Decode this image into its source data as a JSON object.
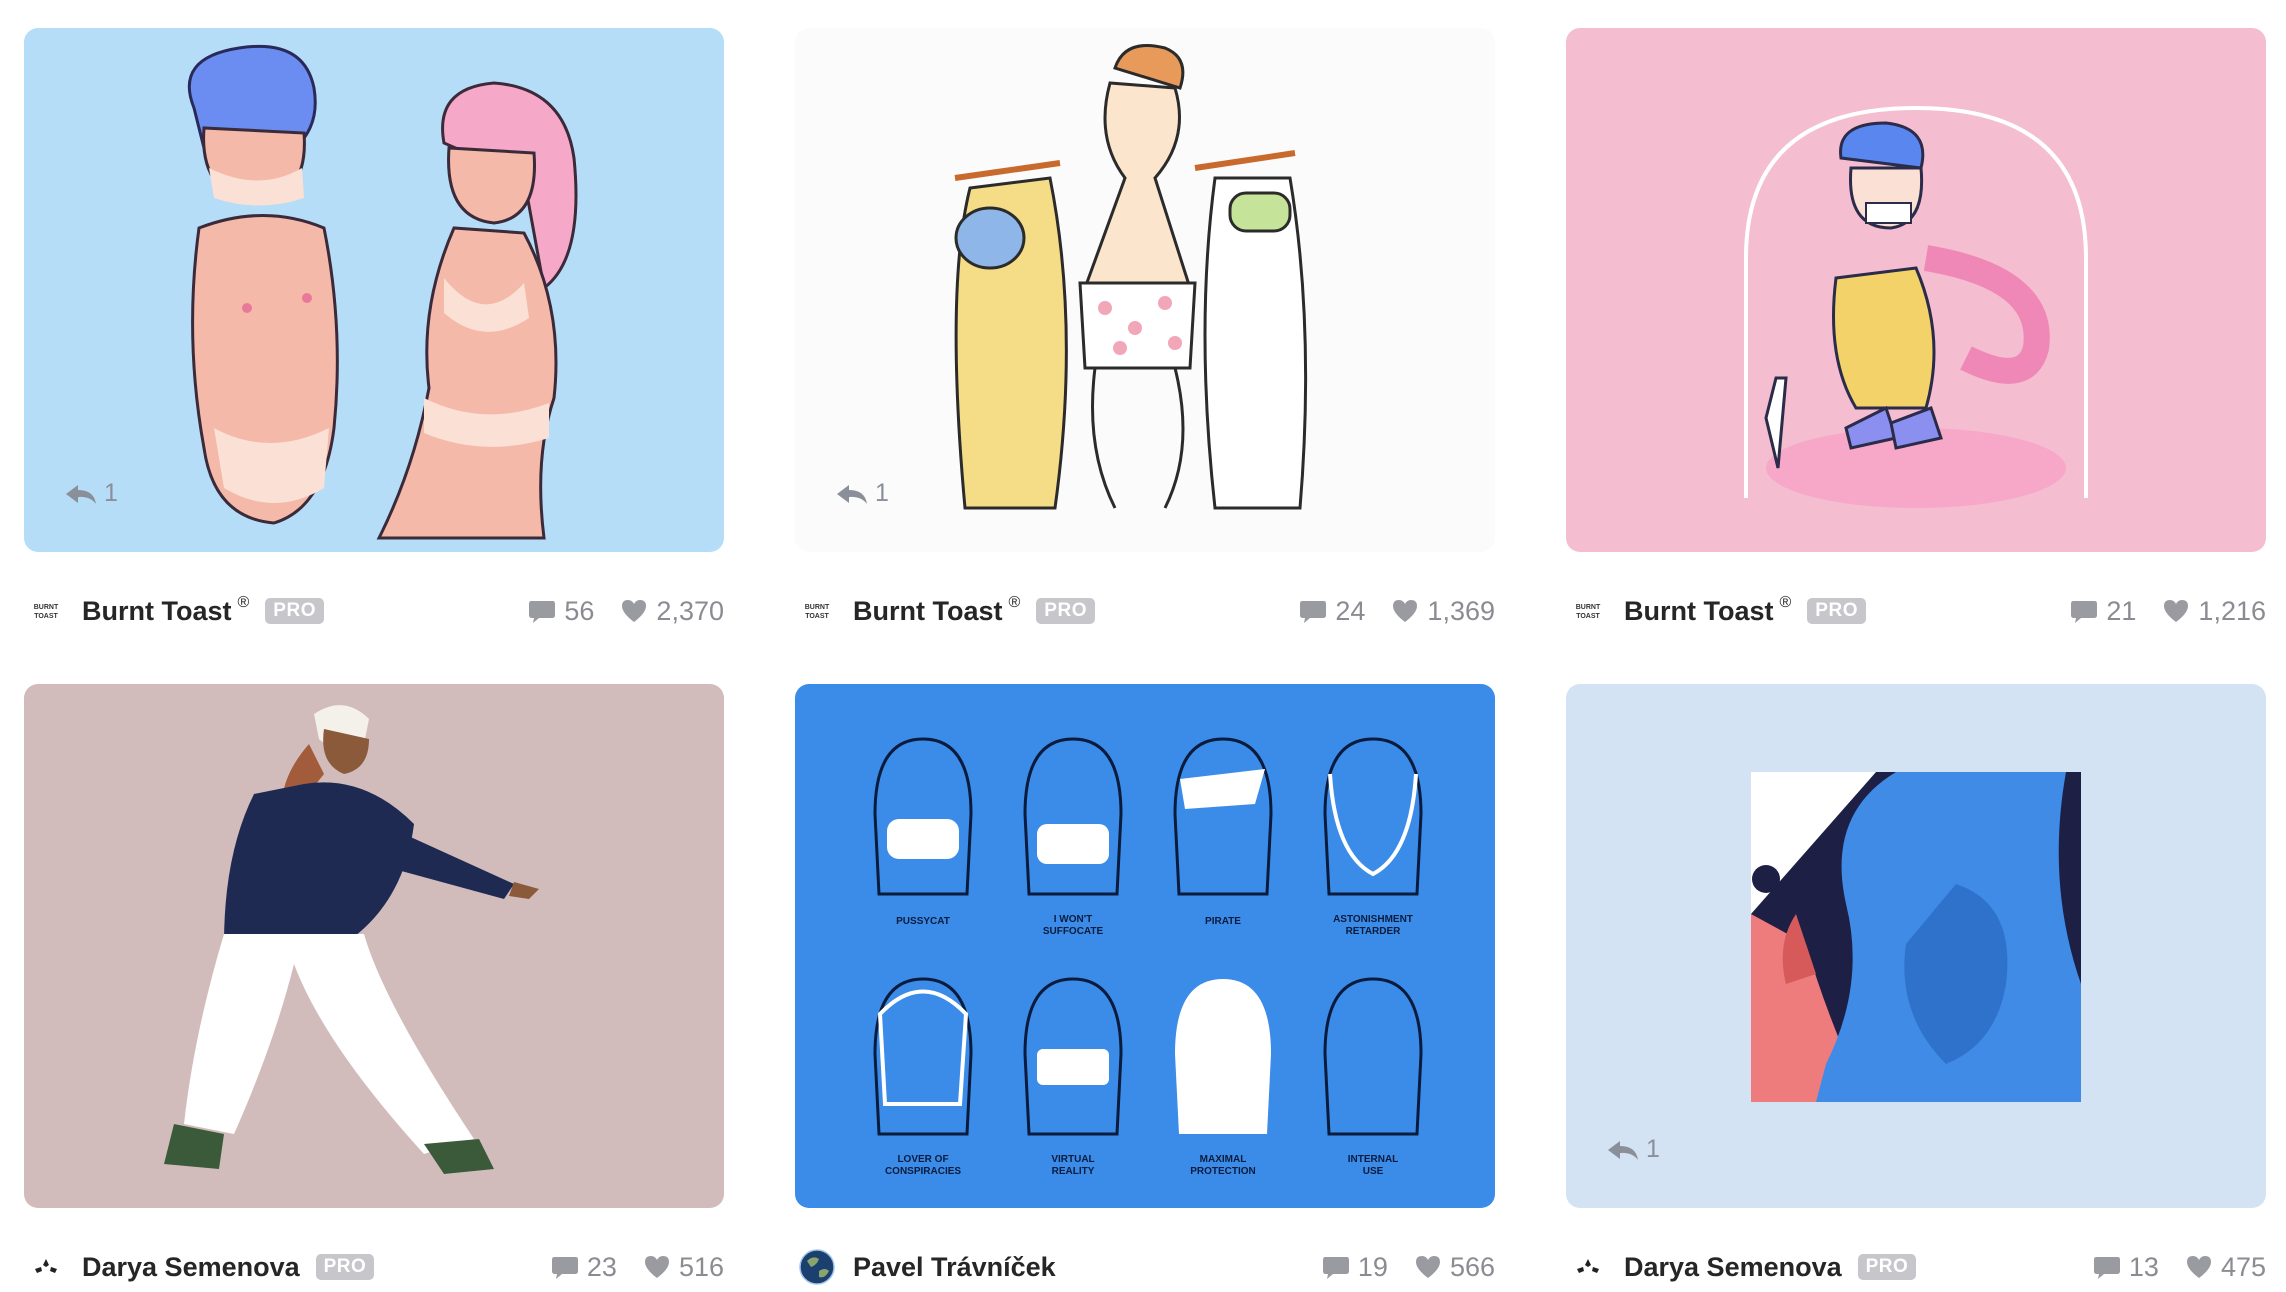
{
  "shots": [
    {
      "author": "Burnt Toast",
      "registered": "®",
      "pro": "PRO",
      "comments": "56",
      "likes": "2,370",
      "rebounds": "1",
      "bg": "#b6ddf8",
      "avatar": "burnt-toast-logo"
    },
    {
      "author": "Burnt Toast",
      "registered": "®",
      "pro": "PRO",
      "comments": "24",
      "likes": "1,369",
      "rebounds": "1",
      "bg": "#fbfbfb",
      "avatar": "burnt-toast-logo"
    },
    {
      "author": "Burnt Toast",
      "registered": "®",
      "pro": "PRO",
      "comments": "21",
      "likes": "1,216",
      "rebounds": "",
      "bg": "#f4bdd0",
      "avatar": "burnt-toast-logo"
    },
    {
      "author": "Darya Semenova",
      "registered": "",
      "pro": "PRO",
      "comments": "23",
      "likes": "516",
      "rebounds": "",
      "bg": "#d2bcbb",
      "avatar": "darya-logo"
    },
    {
      "author": "Pavel Trávníček",
      "registered": "",
      "pro": "",
      "comments": "19",
      "likes": "566",
      "rebounds": "",
      "bg": "#3b8ce8",
      "avatar": "earth-avatar"
    },
    {
      "author": "Darya Semenova",
      "registered": "",
      "pro": "PRO",
      "comments": "13",
      "likes": "475",
      "rebounds": "1",
      "bg": "#d3e3f3",
      "avatar": "darya-logo"
    }
  ],
  "avatar_text": {
    "burnt_toast_1": "BURNT",
    "burnt_toast_2": "TOAST"
  },
  "masks": {
    "top": [
      "PUSSYCAT",
      "I WON'T",
      "SUFFOCATE",
      "PIRATE",
      "ASTONISHMENT",
      "RETARDER"
    ],
    "bottom": [
      "LOVER OF",
      "CONSPIRACIES",
      "VIRTUAL",
      "REALITY",
      "MAXIMAL",
      "PROTECTION",
      "INTERNAL",
      "USE"
    ]
  },
  "colors": {
    "comment_icon": "#9a9aa1",
    "pro_badge": "#c6c6cb"
  }
}
